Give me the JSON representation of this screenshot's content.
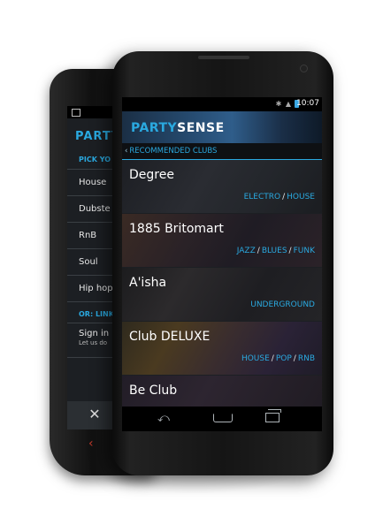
{
  "back_screen": {
    "logo": "PARTYSENSE",
    "pick_label": "PICK YO",
    "genres": [
      "House",
      "Dubste",
      "RnB",
      "Soul",
      "Hip hop"
    ],
    "or_label": "OR: LINK",
    "sign_in": "Sign in",
    "sign_in_sub": "Let us do"
  },
  "status_bar": {
    "time": "10:07"
  },
  "header": {
    "logo_part1": "PARTY",
    "logo_part2": "SENSE"
  },
  "subheader": {
    "back_chevron": "‹",
    "title": "RECOMMENDED CLUBS"
  },
  "clubs": [
    {
      "name": "Degree",
      "tags": [
        "ELECTRO",
        "HOUSE"
      ]
    },
    {
      "name": "1885 Britomart",
      "tags": [
        "JAZZ",
        "BLUES",
        "FUNK"
      ]
    },
    {
      "name": "A'isha",
      "tags": [
        "UNDERGROUND"
      ]
    },
    {
      "name": "Club DELUXE",
      "tags": [
        "HOUSE",
        "POP",
        "RNB"
      ]
    },
    {
      "name": "Be Club",
      "tags": []
    }
  ],
  "colors": {
    "accent": "#2aa9e0",
    "background": "#101215"
  },
  "icons": [
    "image-icon",
    "signal-icon",
    "battery-icon",
    "back-icon",
    "home-icon",
    "recent-apps-icon",
    "close-icon",
    "chevron-left-icon"
  ]
}
